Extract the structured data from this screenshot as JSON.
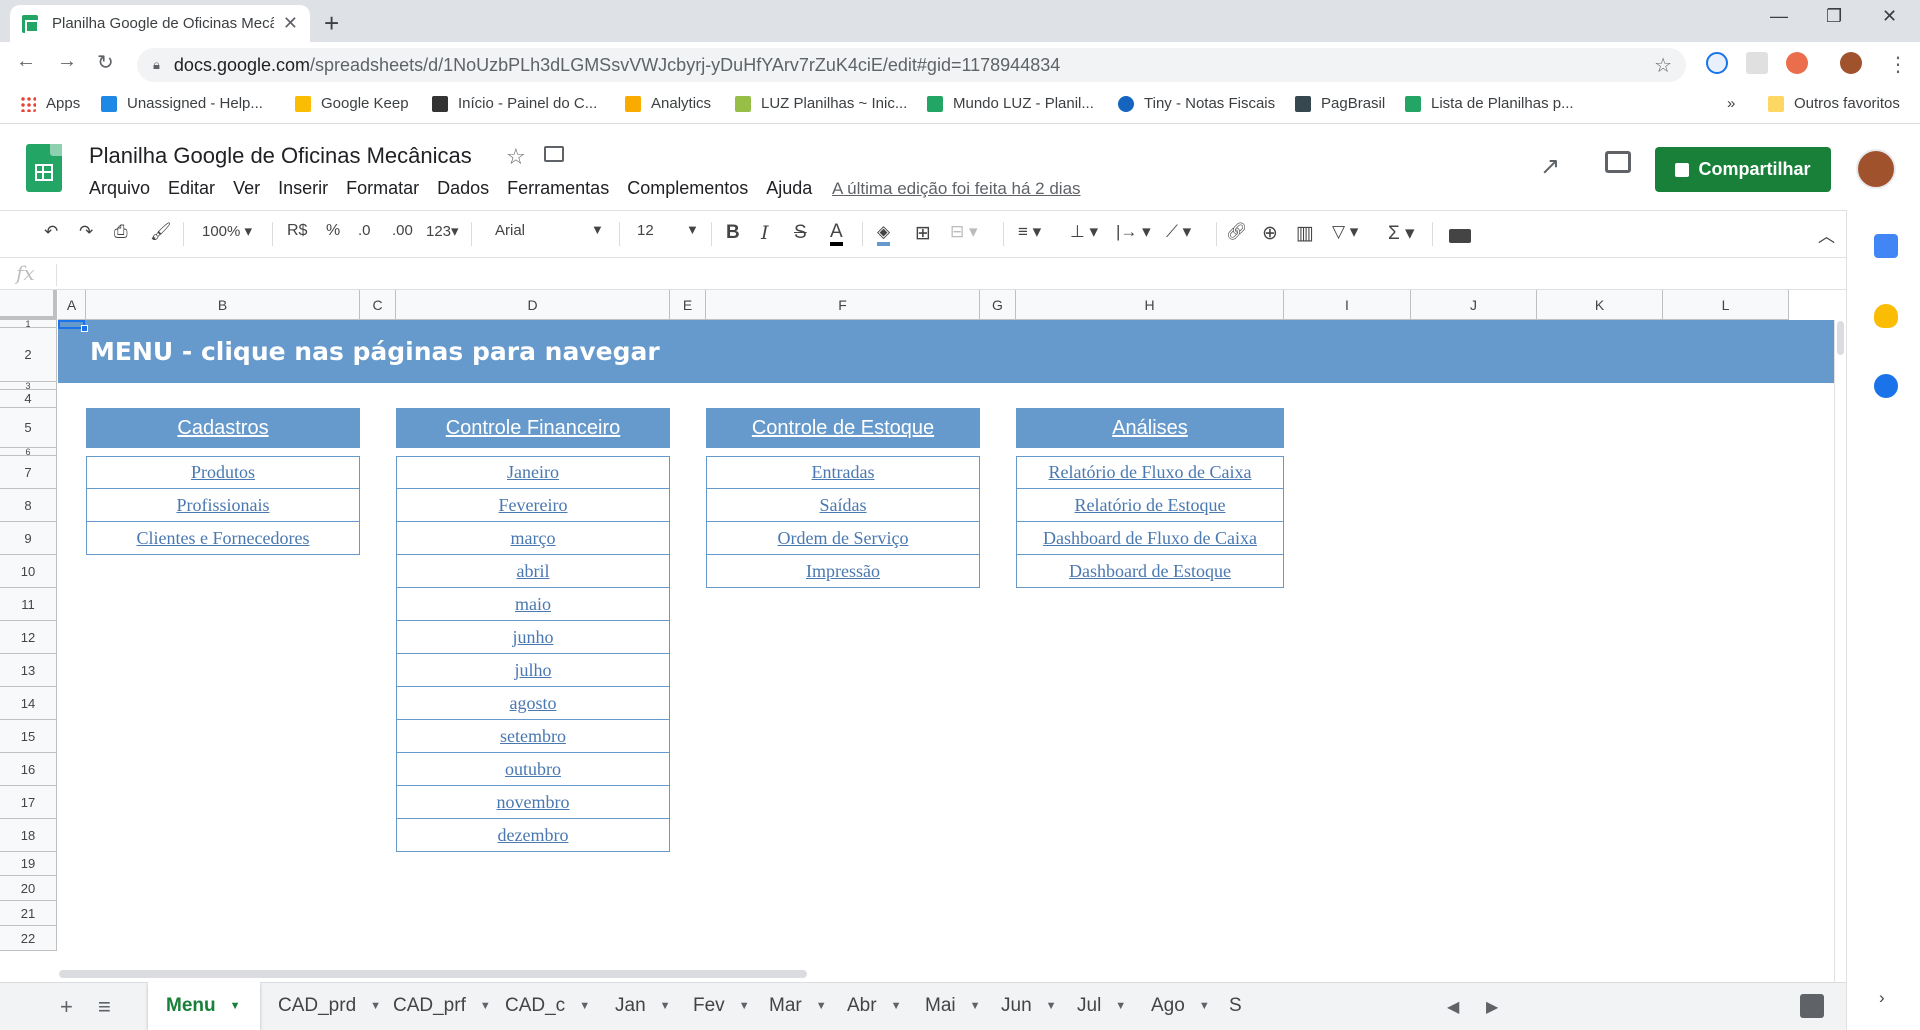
{
  "browser": {
    "tab_title": "Planilha Google de Oficinas Mecânicas",
    "url_host": "docs.google.com",
    "url_path": "/spreadsheets/d/1NoUzbPLh3dLGMSsvVWJcbyrj-yDuHfYArv7rZuK4ciE/edit#gid=1178944834",
    "bookmarks": [
      "Apps",
      "Unassigned - Help...",
      "Google Keep",
      "Início - Painel do C...",
      "Analytics",
      "LUZ Planilhas ~ Inic...",
      "Mundo LUZ - Planil...",
      "Tiny - Notas Fiscais",
      "PagBrasil",
      "Lista de Planilhas p...",
      "Outros favoritos"
    ],
    "bookmarks_more": "»"
  },
  "doc": {
    "title": "Planilha Google de Oficinas Mecânicas",
    "menu": [
      "Arquivo",
      "Editar",
      "Ver",
      "Inserir",
      "Formatar",
      "Dados",
      "Ferramentas",
      "Complementos",
      "Ajuda"
    ],
    "last_edit": "A última edição foi feita há 2 dias",
    "share_label": "Compartilhar"
  },
  "toolbar": {
    "zoom": "100%",
    "currency": "R$",
    "percent": "%",
    "dec_less": ".0",
    "dec_more": ".00",
    "format_more": "123",
    "font": "Arial",
    "font_size": "12"
  },
  "formula_bar": {
    "fx": "fx"
  },
  "grid": {
    "columns": [
      "A",
      "B",
      "C",
      "D",
      "E",
      "F",
      "G",
      "H",
      "I",
      "J",
      "K",
      "L"
    ],
    "rows": [
      "1",
      "2",
      "3",
      "4",
      "5",
      "6",
      "7",
      "8",
      "9",
      "10",
      "11",
      "12",
      "13",
      "14",
      "15",
      "16",
      "17",
      "18",
      "19",
      "20",
      "21",
      "22"
    ],
    "banner": "MENU - clique nas páginas para navegar",
    "categories": [
      {
        "title": "Cadastros",
        "links": [
          "Produtos",
          "Profissionais",
          "Clientes e Fornecedores"
        ]
      },
      {
        "title": "Controle Financeiro",
        "links": [
          "Janeiro",
          "Fevereiro",
          "março",
          "abril",
          "maio",
          "junho",
          "julho",
          "agosto",
          "setembro",
          "outubro",
          "novembro",
          "dezembro"
        ]
      },
      {
        "title": "Controle de Estoque",
        "links": [
          "Entradas",
          "Saídas",
          "Ordem de Serviço",
          "Impressão"
        ]
      },
      {
        "title": "Análises",
        "links": [
          "Relatório de Fluxo de Caixa",
          "Relatório de Estoque",
          "Dashboard de Fluxo de Caixa",
          "Dashboard de Estoque"
        ]
      }
    ]
  },
  "sheet_tabs": [
    "Menu",
    "CAD_prd",
    "CAD_prf",
    "CAD_c",
    "Jan",
    "Fev",
    "Mar",
    "Abr",
    "Mai",
    "Jun",
    "Jul",
    "Ago",
    "S"
  ],
  "active_sheet": "Menu",
  "colors": {
    "accent": "#6699cc",
    "link": "#4a78b0",
    "share": "#188038"
  }
}
